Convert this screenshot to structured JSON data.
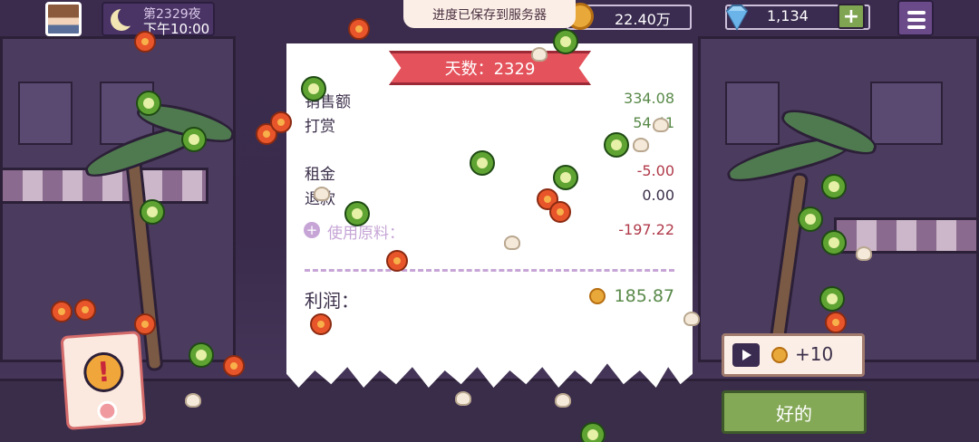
{
  "hud": {
    "day_label": "第2329夜",
    "time_label": "下午10:00",
    "save_toast": "进度已保存到服务器",
    "coins": "22.40万",
    "gems": "1,134",
    "add_label": "+"
  },
  "receipt": {
    "ribbon": "天数：2329",
    "rows": [
      {
        "label": "销售额",
        "value": "334.08",
        "tone": "green"
      },
      {
        "label": "打赏",
        "value": "54.41",
        "tone": "green"
      },
      {
        "label": "租金",
        "value": "-5.00",
        "tone": "red"
      },
      {
        "label": "退款",
        "value": "0.00",
        "tone": "dark"
      }
    ],
    "materials_icon": "+",
    "materials_label": "使用原料：",
    "materials_value": "-197.22",
    "profit_label": "利润：",
    "profit_value": "185.87"
  },
  "ad_button": {
    "label": "+10"
  },
  "ok_button": {
    "label": "好的"
  },
  "alert_card": {
    "symbol": "!"
  },
  "colors": {
    "accent_green": "#83a856",
    "ribbon_red": "#e4525b",
    "gold": "#e9a93a"
  }
}
